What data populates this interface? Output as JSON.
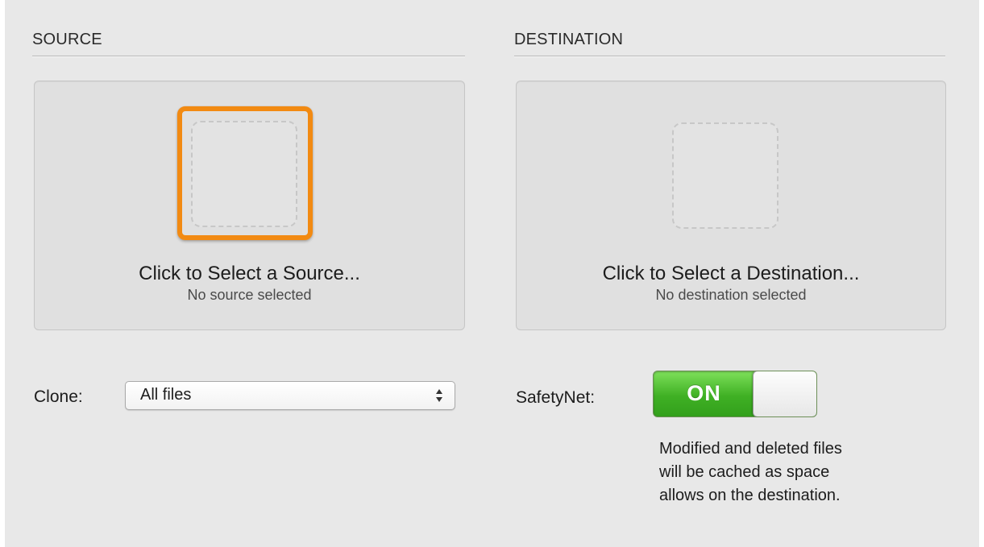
{
  "source": {
    "header": "SOURCE",
    "title": "Click to Select a Source...",
    "status": "No source selected"
  },
  "destination": {
    "header": "DESTINATION",
    "title": "Click to Select a Destination...",
    "status": "No destination selected"
  },
  "clone": {
    "label": "Clone:",
    "selected": "All files"
  },
  "safetynet": {
    "label": "SafetyNet:",
    "toggle_text": "ON",
    "state": "on",
    "description_lines": [
      "Modified and deleted files",
      "will be cached as space",
      "allows on the destination."
    ]
  },
  "colors": {
    "highlight": "#f28a12",
    "toggle_on": "#3fb024"
  },
  "icons": {
    "popup_arrows": "up-down-arrows-icon"
  }
}
